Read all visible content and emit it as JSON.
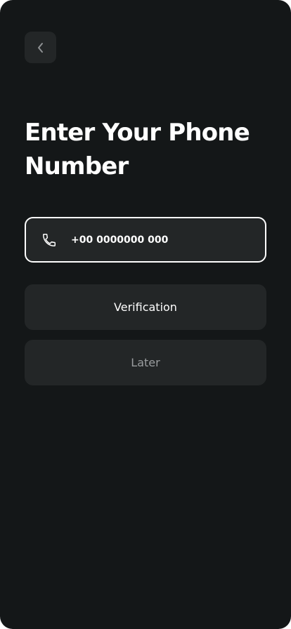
{
  "header": {
    "back_icon": "chevron-left-icon"
  },
  "title": "Enter Your Phone Number",
  "phone": {
    "icon": "phone-icon",
    "value": "+00 0000000 000"
  },
  "buttons": {
    "verification": "Verification",
    "later": "Later"
  },
  "colors": {
    "background": "#141718",
    "surface": "#232627",
    "text": "#ffffff",
    "muted_text": "#9a9d9f",
    "input_border": "#ffffff"
  }
}
